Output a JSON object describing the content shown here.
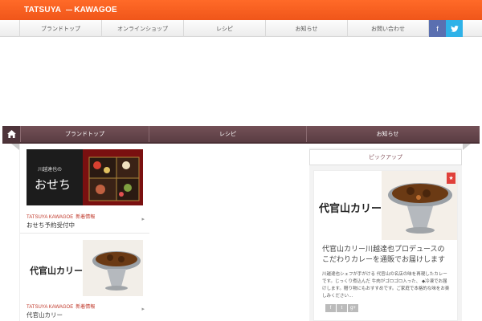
{
  "header": {
    "brand_left": "TATSUYA",
    "brand_right": "KAWAGOE",
    "nav": [
      "ブランドトップ",
      "オンラインショップ",
      "レシピ",
      "お知らせ",
      "お問い合わせ"
    ]
  },
  "social": {
    "facebook": "f",
    "twitter": "🐦"
  },
  "subnav": [
    "ブランドトップ",
    "レシピ",
    "お知らせ"
  ],
  "posts": [
    {
      "brand": "TATSUYA KAWAGOE",
      "category": "新着情報",
      "title": "おせち予約受付中",
      "thumb_text": "おせち",
      "thumb_small": "川越達也の"
    },
    {
      "brand": "TATSUYA KAWAGOE",
      "category": "新着情報",
      "title": "代官山カリー",
      "thumb_text": "代官山カリー"
    }
  ],
  "widget": {
    "heading": "ピックアップ",
    "title": "代官山カリー川越達也プロデュースのこだわりカレーを通販でお届けします",
    "excerpt": "川越達也シェフが手がける 代官山の名店の味を再現したカレーです。じっくり煮込んだ 牛肉がゴロゴロ入った、 ◆冷凍でお届けします。贈り物にもおすすめです。ご家庭で本格的な味をお楽しみください…",
    "image_text": "代官山カリー",
    "share": [
      "f",
      "t",
      "g+"
    ]
  },
  "colors": {
    "accent": "#f0561a",
    "subnav": "#5a3d43",
    "facebook": "#5a6fb0",
    "twitter": "#2fb2e8"
  }
}
